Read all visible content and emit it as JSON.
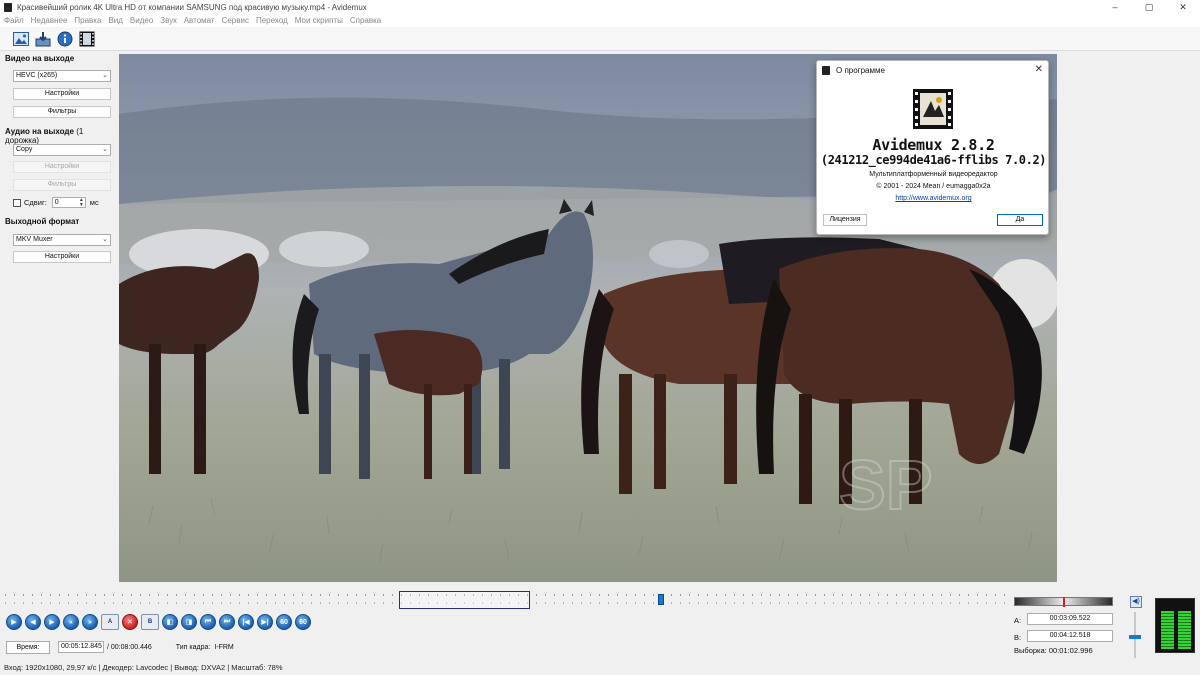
{
  "window": {
    "title": "Красивейший ролик 4K Ultra HD от компании SAMSUNG под красивую музыку.mp4 - Avidemux",
    "controls": [
      "–",
      "▢",
      "✕"
    ]
  },
  "menu": [
    "Файл",
    "Недавнее",
    "Правка",
    "Вид",
    "Видео",
    "Звук",
    "Автомат",
    "Сервис",
    "Переход",
    "Мои скрипты",
    "Справка"
  ],
  "toolbar": {
    "icons": [
      "open-image-icon",
      "save-icon",
      "info-icon",
      "film-strip-icon"
    ]
  },
  "left_panel": {
    "video_output": {
      "title": "Видео на выходе",
      "codec": "HEVC (x265)",
      "settings_label": "Настройки",
      "filters_label": "Фильтры"
    },
    "audio_output": {
      "title": "Аудио на выходе",
      "track_note": "(1 дорожка)",
      "codec": "Copy",
      "settings_label": "Настройки",
      "filters_label": "Фильтры",
      "shift_label": "Сдвиг:",
      "shift_value": "0",
      "shift_unit": "мс"
    },
    "output_format": {
      "title": "Выходной формат",
      "muxer": "MKV Muxer",
      "settings_label": "Настройки"
    }
  },
  "about_dialog": {
    "title": "О программе",
    "app_name": "Avidemux 2.8.2",
    "build": "(241212_ce994de41a6-fflibs 7.0.2)",
    "description": "Мультиплатформенный видеоредактор",
    "copyright": "© 2001 - 2024  Mean / eumagga0x2a",
    "url": "http://www.avidemux.org",
    "license_label": "Лицензия",
    "ok_label": "Да"
  },
  "playback": {
    "buttons": [
      "play",
      "rewind",
      "forward",
      "prev-frame",
      "next-frame",
      "mark-a",
      "delete",
      "mark-b",
      "prev-black",
      "next-black",
      "prev-keyframe",
      "next-keyframe",
      "first-frame",
      "last-frame",
      "back-60",
      "fwd-60"
    ],
    "mark_a_label": "A",
    "mark_b_label": "B",
    "position_fraction": 0.653
  },
  "time_bar": {
    "time_button": "Время:",
    "current_time": "00:05:12.845",
    "total_time": "/ 00:08:00.446",
    "frame_type_label": "Тип кадра:",
    "frame_type": "I-FRM"
  },
  "status": {
    "text": "Вход: 1920x1080, 29,97 к/с  |  Декодер: Lavcodec  |  Вывод: DXVA2  |  Масштаб: 78%"
  },
  "selection_panel": {
    "a_label": "A:",
    "a_value": "00:03:09.522",
    "b_label": "B:",
    "b_value": "00:04:12.518",
    "selection_label": "Выборка:",
    "selection_value": "00:01:02.996",
    "volume_level": 0.45,
    "meter_levels": [
      0.78,
      0.78
    ]
  },
  "colors": {
    "accent": "#1a78d0",
    "selection_border": "#2b2b80",
    "meter_green": "#38d238"
  }
}
